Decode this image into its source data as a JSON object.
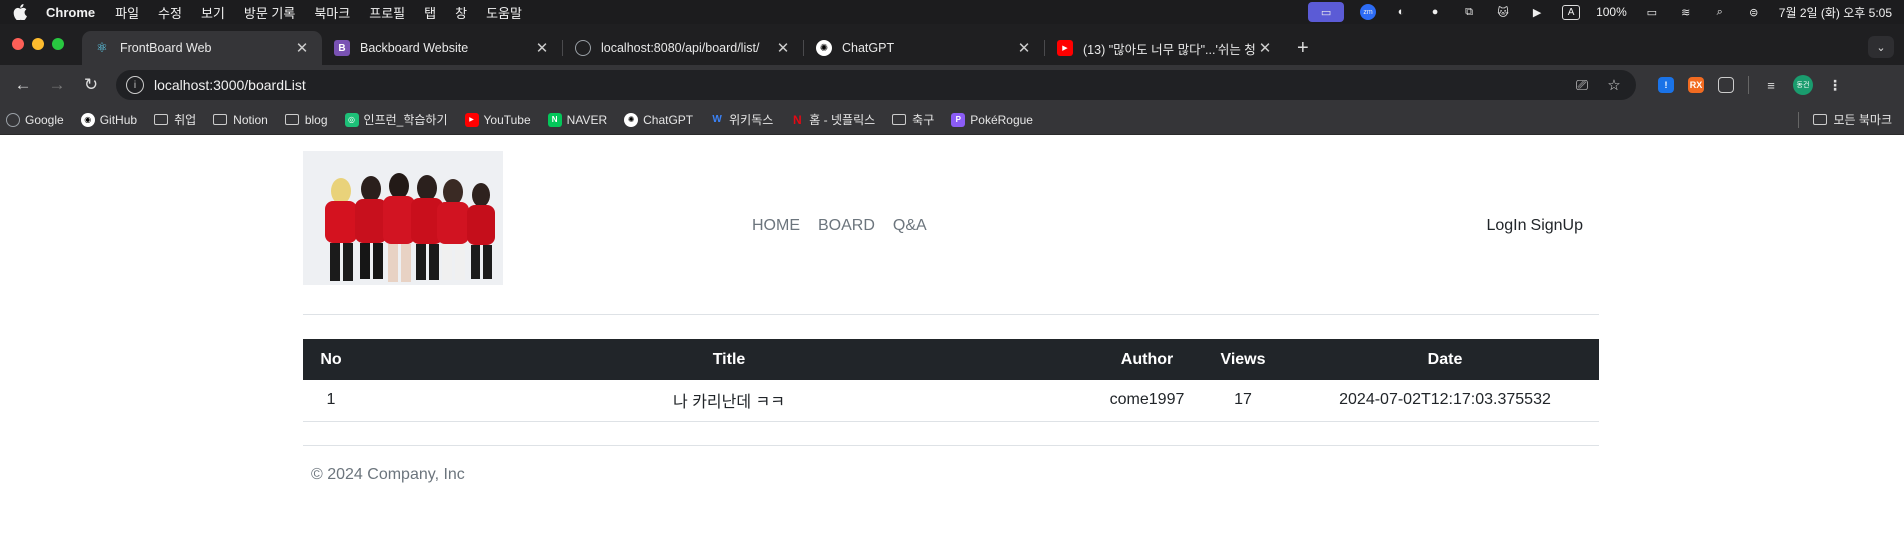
{
  "menubar": {
    "app_name": "Chrome",
    "items": [
      "파일",
      "수정",
      "보기",
      "방문 기록",
      "북마크",
      "프로필",
      "탭",
      "창",
      "도움말"
    ],
    "battery": "100%",
    "clock": "7월 2일 (화) 오후 5:05"
  },
  "tabs": [
    {
      "title": "FrontBoard Web",
      "active": true,
      "favicon": "react-icon",
      "color": "#61dafb"
    },
    {
      "title": "Backboard Website",
      "active": false,
      "favicon": "bootstrap-icon",
      "color": "#7952b3"
    },
    {
      "title": "localhost:8080/api/board/list/",
      "active": false,
      "favicon": "globe-icon",
      "color": "#9aa0a6"
    },
    {
      "title": "ChatGPT",
      "active": false,
      "favicon": "chatgpt-icon",
      "color": "#ffffff"
    },
    {
      "title": "(13) \"많아도 너무 많다\"...'쉬는 청",
      "active": false,
      "favicon": "youtube-icon",
      "color": "#ff0000"
    }
  ],
  "toolbar": {
    "url": "localhost:3000/boardList"
  },
  "bookmarks": [
    {
      "label": "Google",
      "type": "site",
      "icon": "google-icon",
      "color": "#9aa0a6"
    },
    {
      "label": "GitHub",
      "type": "site",
      "icon": "github-icon",
      "color": "#ffffff"
    },
    {
      "label": "취업",
      "type": "folder"
    },
    {
      "label": "Notion",
      "type": "folder"
    },
    {
      "label": "blog",
      "type": "folder"
    },
    {
      "label": "인프런_학습하기",
      "type": "site",
      "icon": "inflearn-icon",
      "color": "#1dc078"
    },
    {
      "label": "YouTube",
      "type": "site",
      "icon": "youtube-icon",
      "color": "#ff0000"
    },
    {
      "label": "NAVER",
      "type": "site",
      "icon": "naver-icon",
      "color": "#03c75a"
    },
    {
      "label": "ChatGPT",
      "type": "site",
      "icon": "chatgpt-icon",
      "color": "#ffffff"
    },
    {
      "label": "위키독스",
      "type": "site",
      "icon": "wikidocs-icon",
      "color": "#3b82f6"
    },
    {
      "label": "홈 - 넷플릭스",
      "type": "site",
      "icon": "netflix-icon",
      "color": "#e50914"
    },
    {
      "label": "축구",
      "type": "folder"
    },
    {
      "label": "PokéRogue",
      "type": "site",
      "icon": "pokerogue-icon",
      "color": "#8b5cf6"
    }
  ],
  "bookmarks_all": "모든 북마크",
  "site": {
    "nav": [
      "HOME",
      "BOARD",
      "Q&A"
    ],
    "login": "LogIn",
    "signup": "SignUp",
    "table": {
      "headers": [
        "No",
        "Title",
        "Author",
        "Views",
        "Date"
      ],
      "rows": [
        [
          "1",
          "나 카리난데 ㅋㅋ",
          "come1997",
          "17",
          "2024-07-02T12:17:03.375532"
        ]
      ]
    },
    "footer": "© 2024 Company, Inc"
  }
}
